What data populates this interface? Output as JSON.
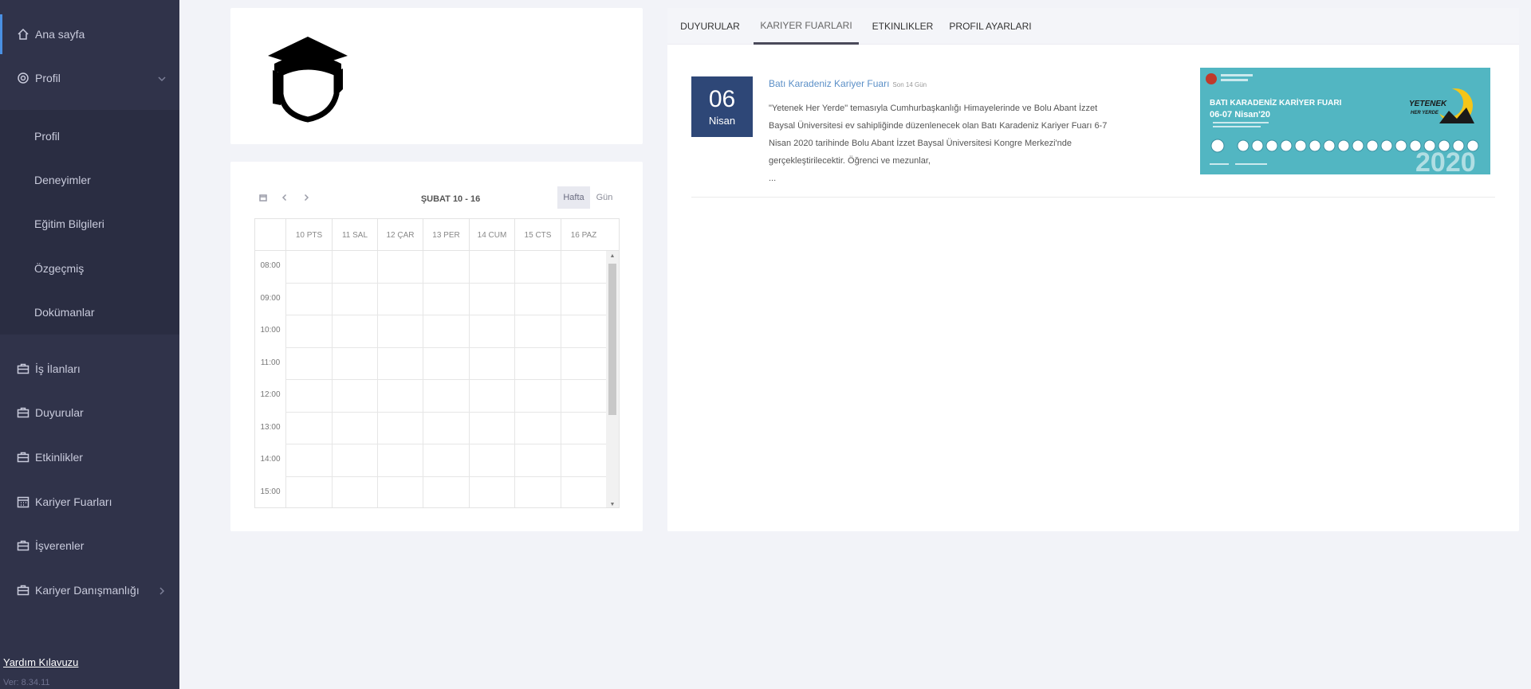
{
  "sidebar": {
    "home": "Ana sayfa",
    "profile_menu": "Profil",
    "submenu": [
      "Profil",
      "Deneyimler",
      "Eğitim Bilgileri",
      "Özgeçmiş",
      "Dokümanlar"
    ],
    "job_listings": "İş İlanları",
    "announcements": "Duyurular",
    "events": "Etkinlikler",
    "career_fairs": "Kariyer Fuarları",
    "employers": "İşverenler",
    "career_counseling": "Kariyer Danışmanlığı",
    "help": "Yardım Kılavuzu",
    "version": "Ver: 8.34.11"
  },
  "calendar": {
    "title": "ŞUBAT 10 - 16",
    "view_week": "Hafta",
    "view_day": "Gün",
    "days": [
      "10 PTS",
      "11 SAL",
      "12 ÇAR",
      "13 PER",
      "14 CUM",
      "15 CTS",
      "16 PAZ"
    ],
    "times": [
      "08:00",
      "09:00",
      "10:00",
      "11:00",
      "12:00",
      "13:00",
      "14:00",
      "15:00"
    ]
  },
  "tabs": [
    "DUYURULAR",
    "KARIYER FUARLARI",
    "ETKINLIKLER",
    "PROFIL AYARLARI"
  ],
  "fair": {
    "day": "06",
    "month": "Nisan",
    "title": "Batı Karadeniz Kariyer Fuarı",
    "meta": "Son 14 Gün",
    "description": "\"Yetenek Her Yerde\" temasıyla Cumhurbaşkanlığı Himayelerinde ve Bolu Abant İzzet Baysal Üniversitesi ev sahipliğinde düzenlenecek olan Batı Karadeniz Kariyer Fuarı 6-7 Nisan 2020 tarihinde Bolu Abant İzzet Baysal Üniversitesi Kongre Merkezi'nde gerçekleştirilecektir. Öğrenci ve mezunlar,",
    "ellipsis": "...",
    "image": {
      "title": "BATI KARADENİZ KARİYER FUARI",
      "dates": "06-07 Nisan'20",
      "slogan_1": "YETENEK",
      "slogan_2": "HER YERDE",
      "year": "2020"
    }
  },
  "colors": {
    "sidebar_bg": "#30334a",
    "submenu_bg": "#2a2d42",
    "date_badge": "#2e4777",
    "link": "#5b8fc7",
    "accent": "#4a90e2"
  }
}
